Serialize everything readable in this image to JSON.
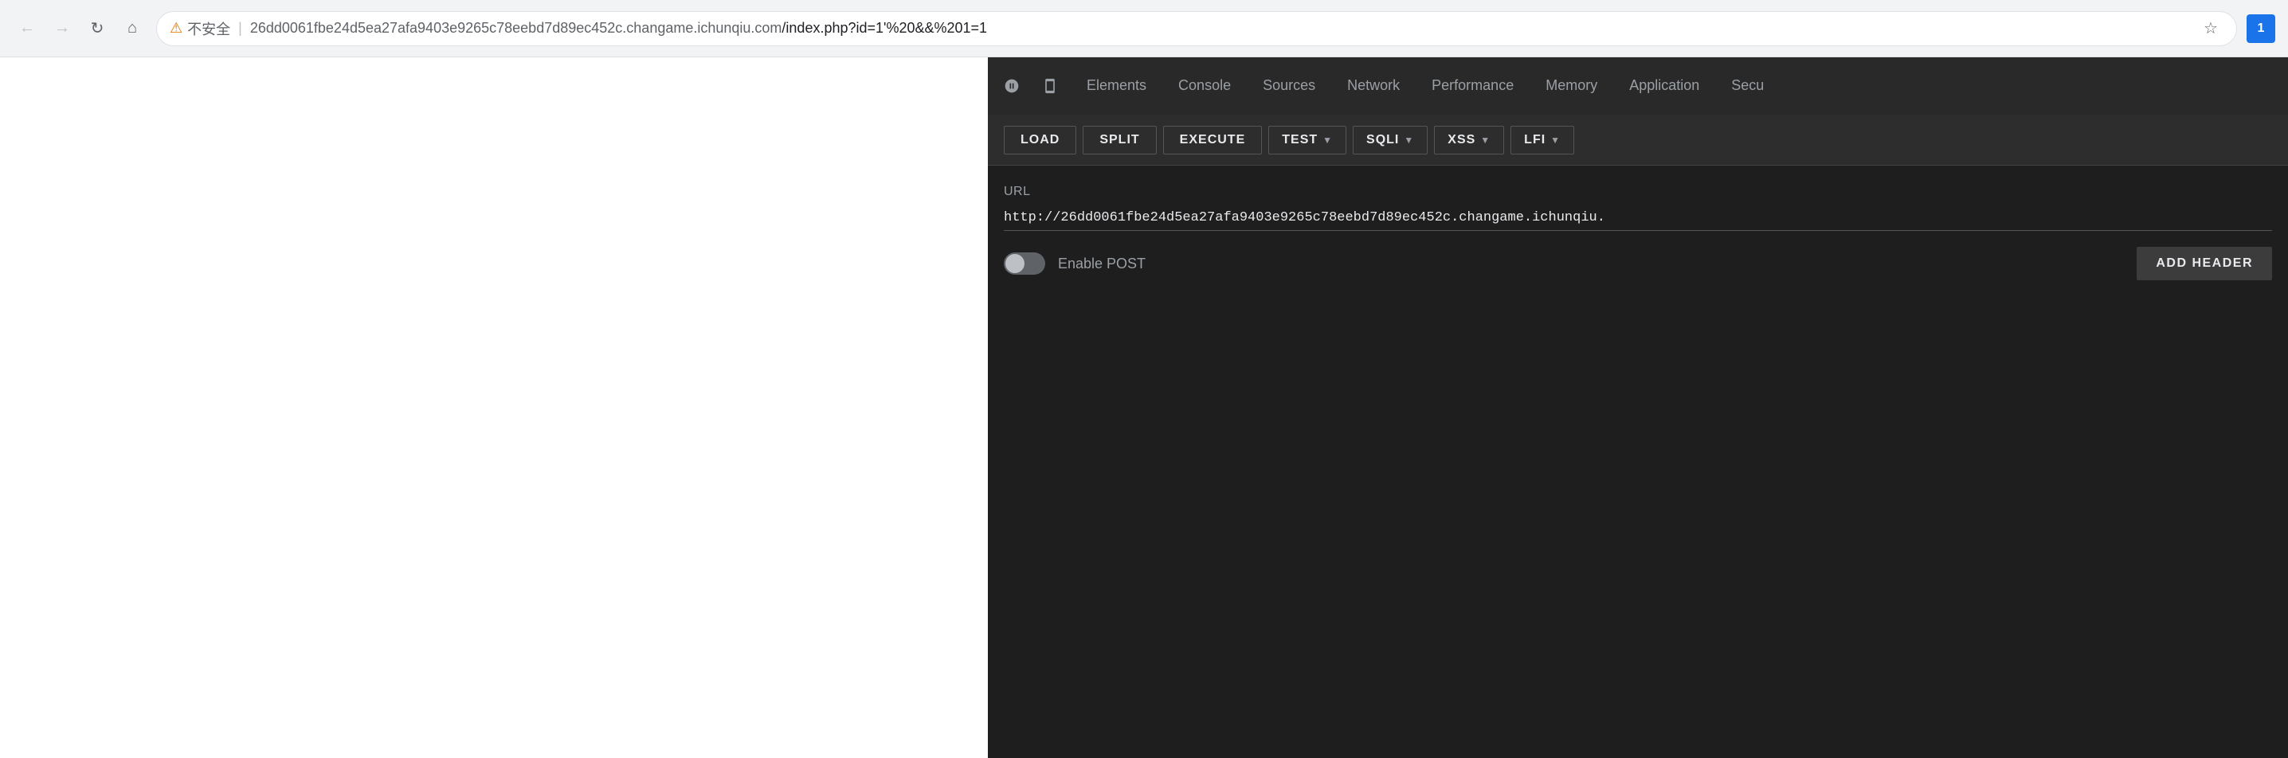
{
  "browser": {
    "nav": {
      "back_label": "←",
      "forward_label": "→",
      "reload_label": "↻",
      "home_label": "⌂"
    },
    "addressbar": {
      "security_icon": "⚠",
      "security_text": "不安全",
      "separator": "|",
      "url_base": "26dd0061fbe24d5ea27afa9403e9265c78eebd7d89ec452c.changame.ichunqiu.com",
      "url_path": "/index.php?id=1'%20&&%201=1",
      "full_url": "26dd0061fbe24d5ea27afa9403e9265c78eebd7d89ec452c.changame.ichunqiu.com/index.php?id=1'%20&&%201=1"
    },
    "star_icon": "☆",
    "extension_label": "1"
  },
  "devtools": {
    "tabs": [
      {
        "label": "Elements",
        "active": false
      },
      {
        "label": "Console",
        "active": false
      },
      {
        "label": "Sources",
        "active": false
      },
      {
        "label": "Network",
        "active": false
      },
      {
        "label": "Performance",
        "active": false
      },
      {
        "label": "Memory",
        "active": false
      },
      {
        "label": "Application",
        "active": false
      },
      {
        "label": "Secu",
        "active": false
      }
    ]
  },
  "hackbar": {
    "toolbar": {
      "buttons": [
        {
          "label": "LOAD",
          "has_dropdown": false
        },
        {
          "label": "SPLIT",
          "has_dropdown": false
        },
        {
          "label": "EXECUTE",
          "has_dropdown": false
        },
        {
          "label": "TEST",
          "has_dropdown": true
        },
        {
          "label": "SQLI",
          "has_dropdown": true
        },
        {
          "label": "XSS",
          "has_dropdown": true
        },
        {
          "label": "LFI",
          "has_dropdown": true
        }
      ]
    },
    "url_section": {
      "label": "URL",
      "value": "http://26dd0061fbe24d5ea27afa9403e9265c78eebd7d89ec452c.changame.ichunqiu."
    },
    "enable_post": {
      "label": "Enable POST",
      "enabled": false
    },
    "add_header_label": "ADD HEADER"
  }
}
